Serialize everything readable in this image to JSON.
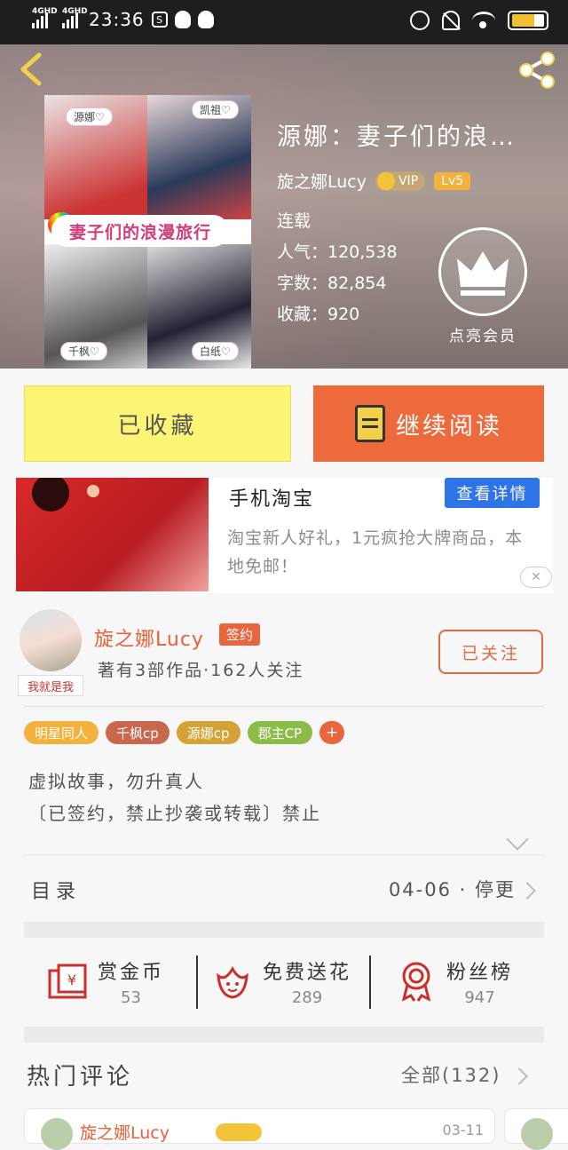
{
  "status_bar": {
    "net1": "4GHD",
    "net2": "4GHD",
    "time": "23:36",
    "app_icon": "S"
  },
  "book": {
    "title": "源娜：妻子们的浪…",
    "author": "旋之娜Lucy",
    "vip_label": "VIP",
    "level": "Lv5",
    "status": "连载",
    "popularity": "人气：120,538",
    "word_count": "字数：82,854",
    "favorites": "收藏：920",
    "member_label": "点亮会员",
    "cover": {
      "banner": "妻子们的浪漫旅行",
      "tags": [
        "源娜♡",
        "凯祖♡",
        "千枫♡",
        "白纸♡"
      ]
    }
  },
  "actions": {
    "favorited": "已收藏",
    "continue": "继续阅读"
  },
  "ad": {
    "title": "手机淘宝",
    "button": "查看详情",
    "desc": "淘宝新人好礼，1元疯抢大牌商品，本地免邮！",
    "close": "✕"
  },
  "author_card": {
    "name": "旋之娜Lucy",
    "badge": "签约",
    "meta": "著有3部作品·162人关注",
    "avatar_caption": "我就是我",
    "follow": "已关注"
  },
  "tags": [
    {
      "label": "明星同人",
      "color": "#f3b13d"
    },
    {
      "label": "千枫cp",
      "color": "#c8674e"
    },
    {
      "label": "源娜cp",
      "color": "#d4a235"
    },
    {
      "label": "郡主CP",
      "color": "#8dbb48"
    }
  ],
  "tag_add": "+",
  "description": {
    "line1": "虚拟故事，勿升真人",
    "line2": "〔已签约，禁止抄袭或转载〕禁止"
  },
  "toc": {
    "label": "目录",
    "date": "04-06",
    "status": "停更"
  },
  "rewards": [
    {
      "label": "赏金币",
      "value": "53",
      "icon": "red-envelope-icon"
    },
    {
      "label": "免费送花",
      "value": "289",
      "icon": "flower-icon"
    },
    {
      "label": "粉丝榜",
      "value": "947",
      "icon": "medal-icon"
    }
  ],
  "comments": {
    "heading": "热门评论",
    "all": "全部(132)",
    "first": {
      "name": "旋之娜Lucy",
      "date": "03-11"
    }
  }
}
